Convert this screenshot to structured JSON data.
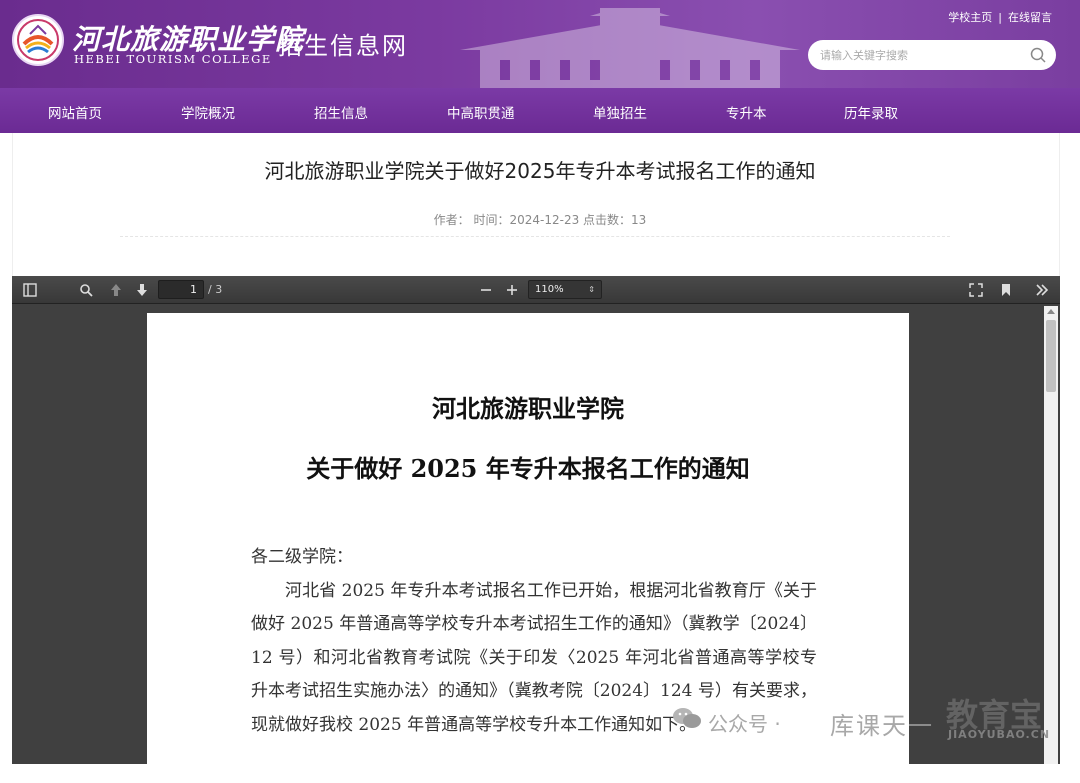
{
  "header": {
    "logo_cn": "河北旅游职业学院",
    "logo_en": "HEBEI TOURISM COLLEGE",
    "site_name": "招生信息网",
    "top_links": [
      "学校主页",
      "在线留言"
    ],
    "top_links_sep": "|",
    "search_placeholder": "请输入关键字搜索",
    "brand_color": "#6b2a94"
  },
  "nav": {
    "items": [
      "网站首页",
      "学院概况",
      "招生信息",
      "中高职贯通",
      "单独招生",
      "专升本",
      "历年录取"
    ]
  },
  "article": {
    "title": "河北旅游职业学院关于做好2025年专升本考试报名工作的通知",
    "meta": "作者： 时间：2024-12-23 点击数：13"
  },
  "pdf_viewer": {
    "current_page": "1",
    "page_count": "/ 3",
    "zoom": "110%",
    "icons": [
      "sidebar-toggle-icon",
      "search-icon",
      "arrow-up-icon",
      "arrow-down-icon",
      "minus-icon",
      "plus-icon",
      "fullscreen-icon",
      "bookmark-icon",
      "double-chevron-right-icon"
    ]
  },
  "document": {
    "heading_1": "河北旅游职业学院",
    "heading_2": "关于做好 2025 年专升本报名工作的通知",
    "greeting": "各二级学院：",
    "paragraph": "河北省 2025 年专升本考试报名工作已开始，根据河北省教育厅《关于做好 2025 年普通高等学校专升本考试招生工作的通知》（冀教学〔2024〕12 号）和河北省教育考试院《关于印发〈2025 年河北省普通高等学校专升本考试招生实施办法〉的通知》（冀教考院〔2024〕124 号）有关要求，现就做好我校 2025 年普通高等学校专升本工作通知如下。"
  },
  "watermark": {
    "wechat_label": "公众号 ·",
    "name": "库课天一",
    "brand": "教育宝",
    "brand_url": "JIAOYUBAO.CN"
  }
}
